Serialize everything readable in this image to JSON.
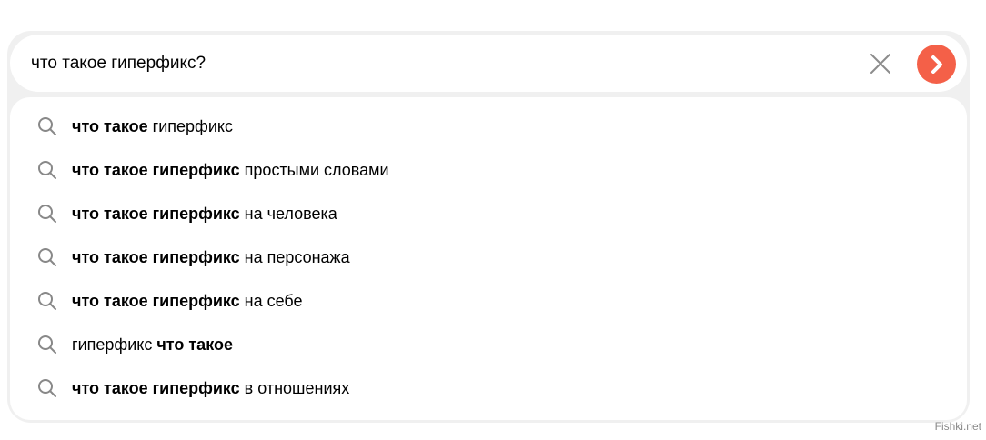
{
  "search": {
    "query": "что такое гиперфикс?",
    "clear_icon": "close-icon",
    "go_icon": "chevron-right-icon",
    "accent": "#f46048"
  },
  "suggestions": [
    {
      "bold": "что такое",
      "rest": " гиперфикс",
      "bold_first": true
    },
    {
      "bold": "что такое гиперфикс",
      "rest": " простыми словами",
      "bold_first": true
    },
    {
      "bold": "что такое гиперфикс",
      "rest": " на человека",
      "bold_first": true
    },
    {
      "bold": "что такое гиперфикс",
      "rest": " на персонажа",
      "bold_first": true
    },
    {
      "bold": "что такое гиперфикс",
      "rest": " на себе",
      "bold_first": true
    },
    {
      "bold": "что такое",
      "rest": "гиперфикс ",
      "bold_first": false
    },
    {
      "bold": "что такое гиперфикс",
      "rest": " в отношениях",
      "bold_first": true
    }
  ],
  "suggestion_icon": "search-icon",
  "watermark": "Fishki.net"
}
